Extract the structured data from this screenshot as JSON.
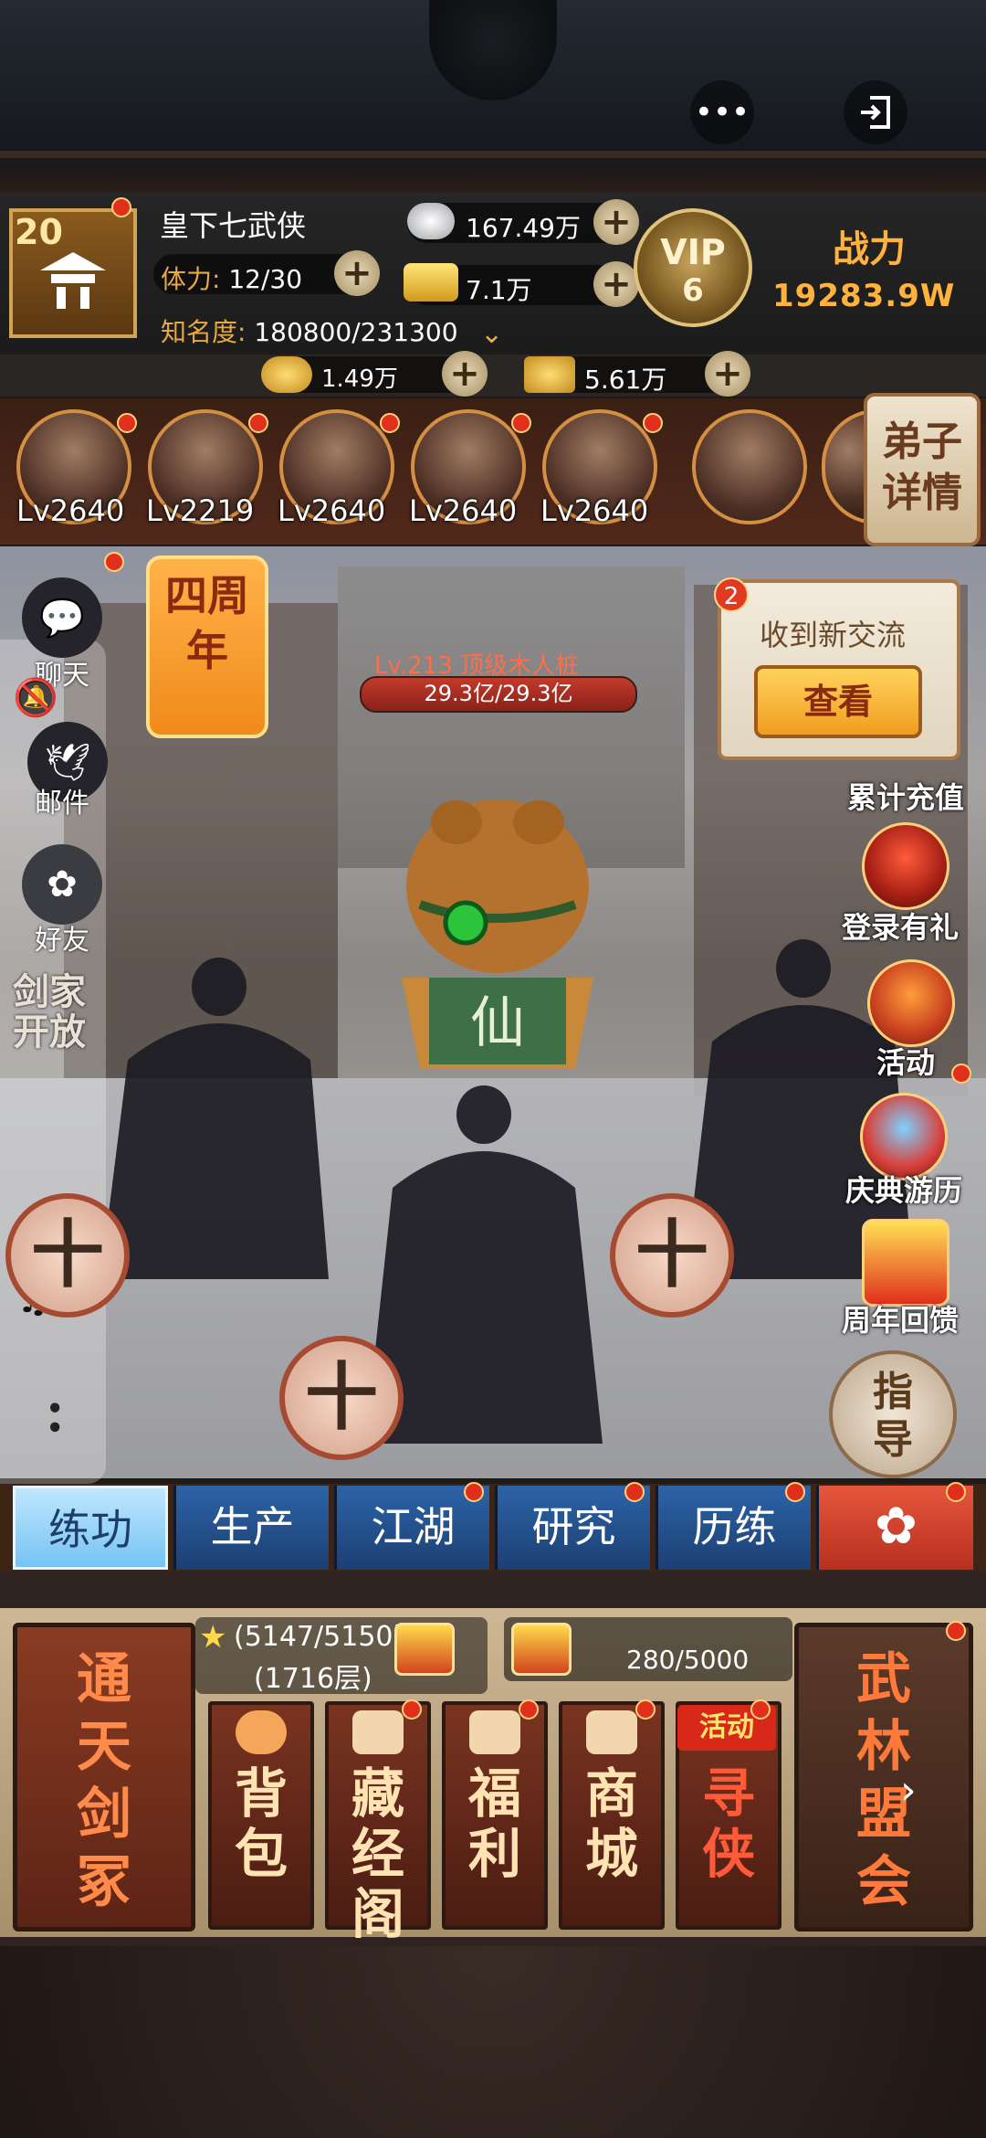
{
  "top": {
    "more_icon": "more-dots-icon",
    "exit_icon": "exit-icon"
  },
  "player": {
    "level": "20",
    "name": "皇下七武侠",
    "stamina_label": "体力:",
    "stamina_value": "12/30",
    "fame_label": "知名度:",
    "fame_value": "180800/231300",
    "silver": "167.49万",
    "gold": "7.1万",
    "vip_label": "VIP",
    "vip_level": "6",
    "power_label": "战力",
    "power_value": "19283.9W"
  },
  "currencies": {
    "ingot": "1.49万",
    "token": "5.61万"
  },
  "disciples": [
    {
      "level": "Lv2640"
    },
    {
      "level": "Lv2219"
    },
    {
      "level": "Lv2640"
    },
    {
      "level": "Lv2640"
    },
    {
      "level": "Lv2640"
    },
    {
      "level": ""
    }
  ],
  "disciple_detail_label": "弟子详情",
  "left_menu": {
    "chat": "聊天",
    "mail": "邮件",
    "friends": "好友",
    "sword": "剑家开放"
  },
  "anniversary": "四周年",
  "boss": {
    "name": "Lv.213 顶级木人桩",
    "hp": "29.3亿/29.3亿",
    "badge": "仙"
  },
  "message": {
    "count": "2",
    "title": "收到新交流",
    "button": "查看"
  },
  "right_menu": [
    "累计充值",
    "登录有礼",
    "活动",
    "庆典游历",
    "周年回馈"
  ],
  "guide_label": "指导",
  "tabs": [
    "练功",
    "生产",
    "江湖",
    "研究",
    "历练"
  ],
  "tower": {
    "progress": "(5147/5150)",
    "floor": "(1716层)",
    "title": "通天剑冢"
  },
  "shop_progress": "280/5000",
  "cards": [
    "背包",
    "藏经阁",
    "福利",
    "商城",
    "寻侠"
  ],
  "card_tag": "活动",
  "alliance": "武林盟会"
}
